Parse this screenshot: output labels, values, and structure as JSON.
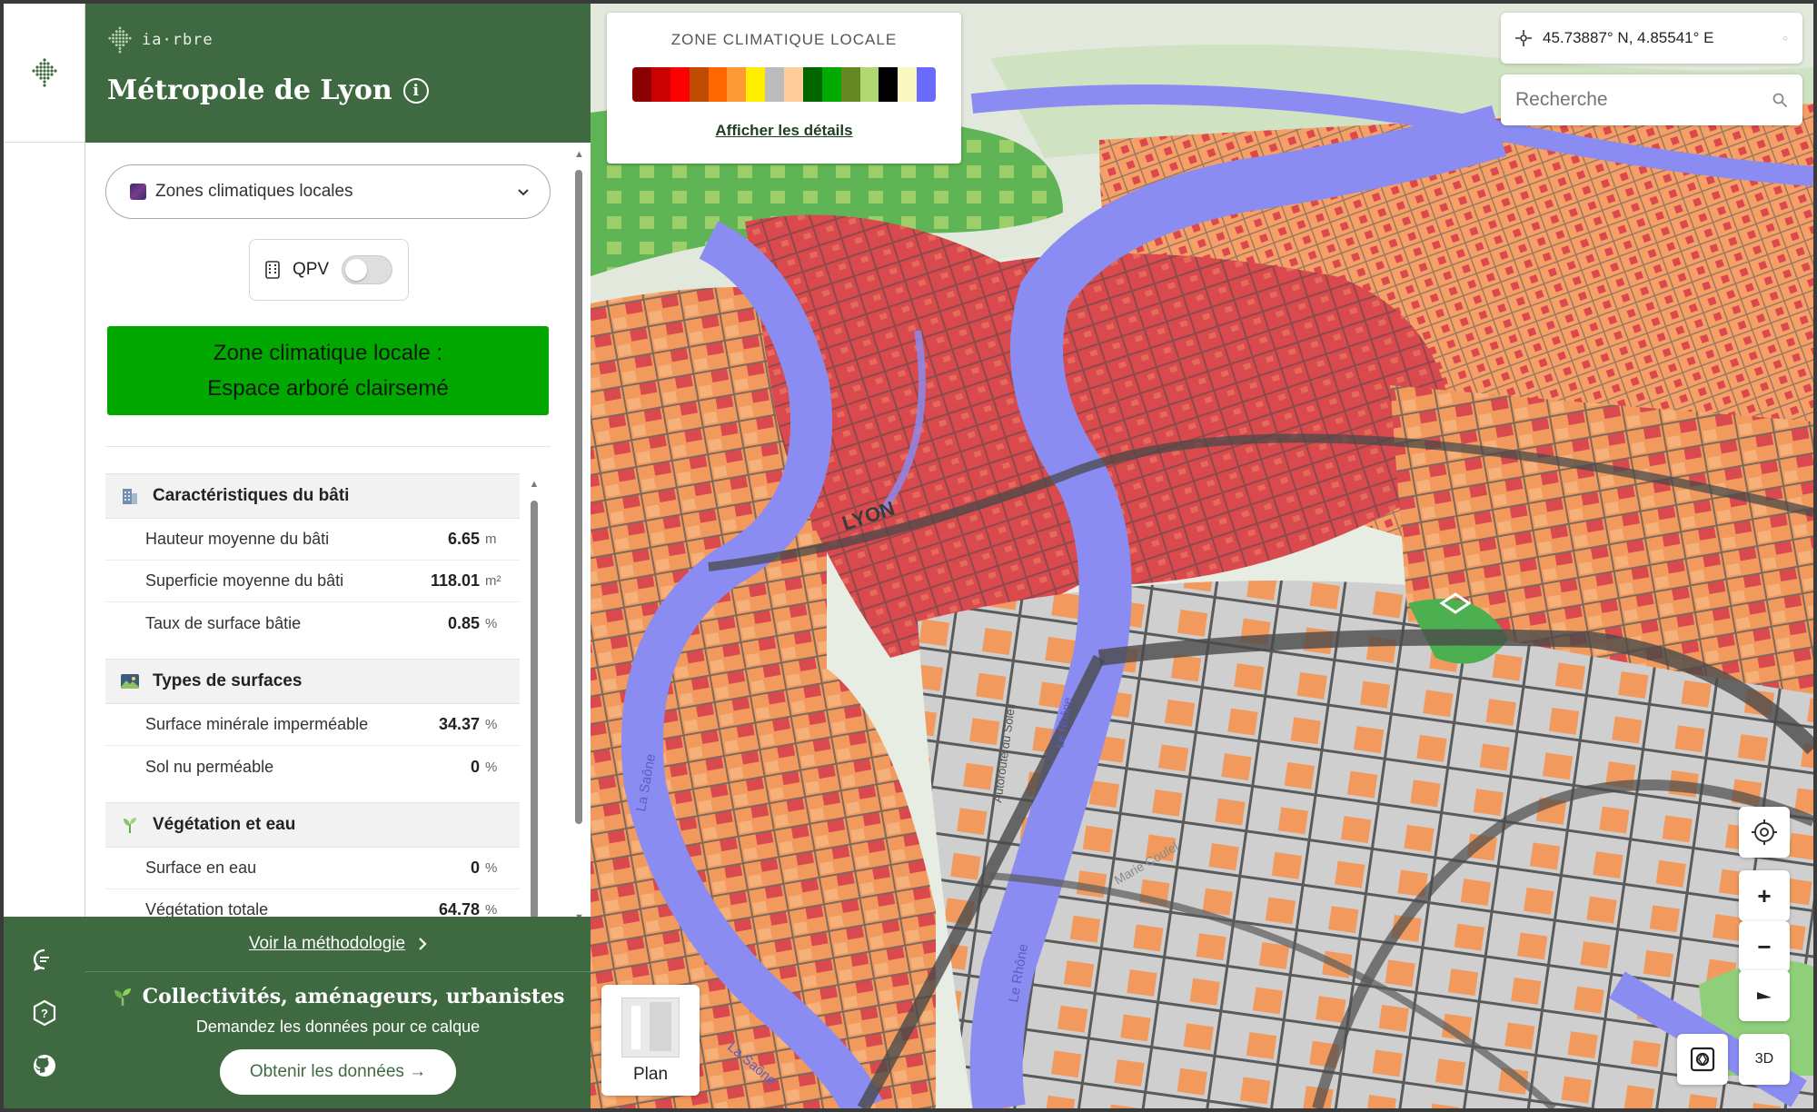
{
  "brand": {
    "name": "ia·rbre"
  },
  "header": {
    "title": "Métropole de Lyon"
  },
  "layer_select": {
    "label": "Zones climatiques locales"
  },
  "qpv": {
    "label": "QPV",
    "enabled": false
  },
  "zone_banner": {
    "line1": "Zone climatique locale :",
    "line2": "Espace arboré clairsemé",
    "color": "#00a800"
  },
  "sections": [
    {
      "title": "Caractéristiques du bâti",
      "icon": "building-icon",
      "rows": [
        {
          "label": "Hauteur moyenne du bâti",
          "value": "6.65",
          "unit": "m"
        },
        {
          "label": "Superficie moyenne du bâti",
          "value": "118.01",
          "unit": "m²"
        },
        {
          "label": "Taux de surface bâtie",
          "value": "0.85",
          "unit": "%"
        }
      ]
    },
    {
      "title": "Types de surfaces",
      "icon": "landscape-icon",
      "rows": [
        {
          "label": "Surface minérale imperméable",
          "value": "34.37",
          "unit": "%"
        },
        {
          "label": "Sol nu perméable",
          "value": "0",
          "unit": "%"
        }
      ]
    },
    {
      "title": "Végétation et eau",
      "icon": "plant-icon",
      "rows": [
        {
          "label": "Surface en eau",
          "value": "0",
          "unit": "%"
        },
        {
          "label": "Végétation totale",
          "value": "64.78",
          "unit": "%"
        }
      ]
    }
  ],
  "footer": {
    "method_link": "Voir la méthodologie",
    "cta_title": "Collectivités, aménageurs, urbanistes",
    "cta_subtitle": "Demandez les données pour ce calque",
    "cta_button": "Obtenir les données →"
  },
  "legend": {
    "title": "ZONE CLIMATIQUE LOCALE",
    "link": "Afficher les détails",
    "colors": [
      "#8b0000",
      "#cc0000",
      "#ff0000",
      "#c04a00",
      "#ff6600",
      "#ff9933",
      "#ffee00",
      "#bbbbbb",
      "#ffcc99",
      "#006600",
      "#00aa00",
      "#668822",
      "#b0d872",
      "#000000",
      "#fbf7c0",
      "#6a6aff"
    ]
  },
  "map": {
    "coordinates": "45.73887° N, 4.85541° E",
    "search_placeholder": "Recherche",
    "labels": {
      "city": "LYON",
      "saone": "La Saône",
      "rhone": "Le Rhône",
      "autoroute": "Autoroute du Soleil",
      "marie": "Marie Coulel"
    },
    "plan_label": "Plan",
    "btn_3d": "3D",
    "zoom_in": "+",
    "zoom_out": "−"
  },
  "rail": {
    "icons": [
      "chat-icon",
      "help-icon",
      "github-icon"
    ]
  }
}
